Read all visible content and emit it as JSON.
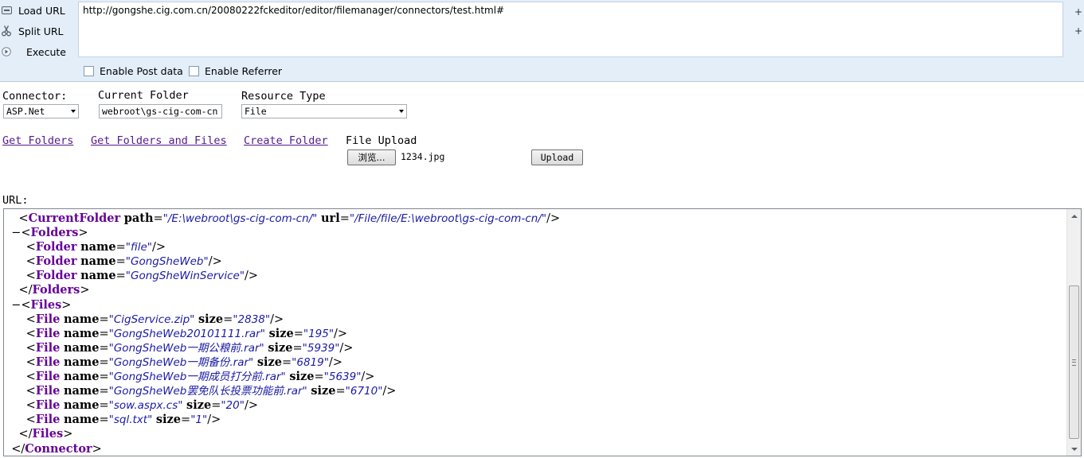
{
  "hackbar": {
    "load_url": "Load URL",
    "split_url": "Split URL",
    "execute": "Execute",
    "url_value": "http://gongshe.cig.com.cn/20080222fckeditor/editor/filemanager/connectors/test.html#",
    "plus": "+",
    "enable_post": "Enable Post data",
    "enable_referrer": "Enable Referrer"
  },
  "form": {
    "connector_label": "Connector:",
    "connector_value": "ASP.Net",
    "current_folder_label": "Current Folder",
    "current_folder_value": "webroot\\gs-cig-com-cn",
    "resource_type_label": "Resource Type",
    "resource_type_value": "File",
    "get_folders": "Get Folders",
    "get_folders_files": "Get Folders and Files",
    "create_folder": "Create Folder",
    "file_upload_label": "File Upload",
    "browse_button": "浏览...",
    "file_name": "1234.jpg",
    "upload_button": "Upload",
    "url_label": "URL:"
  },
  "xml": {
    "lines": [
      {
        "indent": "    ",
        "toggle": "",
        "tag": "CurrentFolder",
        "close": false,
        "self": false,
        "attrs": [
          {
            "n": "path",
            "v": "/E:\\webroot\\gs-cig-com-cn/"
          },
          {
            "n": "url",
            "v": "/File/file/E:\\webroot\\gs-cig-com-cn/"
          }
        ],
        "end": "/>"
      },
      {
        "indent": "  ",
        "toggle": "−",
        "tag": "Folders",
        "close": false,
        "attrs": [],
        "end": ">"
      },
      {
        "indent": "      ",
        "toggle": "",
        "tag": "Folder",
        "close": false,
        "attrs": [
          {
            "n": "name",
            "v": "file"
          }
        ],
        "end": "/>"
      },
      {
        "indent": "      ",
        "toggle": "",
        "tag": "Folder",
        "close": false,
        "attrs": [
          {
            "n": "name",
            "v": "GongSheWeb"
          }
        ],
        "end": "/>"
      },
      {
        "indent": "      ",
        "toggle": "",
        "tag": "Folder",
        "close": false,
        "attrs": [
          {
            "n": "name",
            "v": "GongSheWinService"
          }
        ],
        "end": "/>"
      },
      {
        "indent": "    ",
        "toggle": "",
        "tag": "Folders",
        "close": true,
        "attrs": [],
        "end": ">"
      },
      {
        "indent": "  ",
        "toggle": "−",
        "tag": "Files",
        "close": false,
        "attrs": [],
        "end": ">"
      },
      {
        "indent": "      ",
        "toggle": "",
        "tag": "File",
        "close": false,
        "attrs": [
          {
            "n": "name",
            "v": "CigService.zip"
          },
          {
            "n": "size",
            "v": "2838"
          }
        ],
        "end": "/>"
      },
      {
        "indent": "      ",
        "toggle": "",
        "tag": "File",
        "close": false,
        "attrs": [
          {
            "n": "name",
            "v": "GongSheWeb20101111.rar"
          },
          {
            "n": "size",
            "v": "195"
          }
        ],
        "end": "/>"
      },
      {
        "indent": "      ",
        "toggle": "",
        "tag": "File",
        "close": false,
        "attrs": [
          {
            "n": "name",
            "v": "GongSheWeb一期公粮前.rar"
          },
          {
            "n": "size",
            "v": "5939"
          }
        ],
        "end": "/>"
      },
      {
        "indent": "      ",
        "toggle": "",
        "tag": "File",
        "close": false,
        "attrs": [
          {
            "n": "name",
            "v": "GongSheWeb一期备份.rar"
          },
          {
            "n": "size",
            "v": "6819"
          }
        ],
        "end": "/>"
      },
      {
        "indent": "      ",
        "toggle": "",
        "tag": "File",
        "close": false,
        "attrs": [
          {
            "n": "name",
            "v": "GongSheWeb一期成员打分前.rar"
          },
          {
            "n": "size",
            "v": "5639"
          }
        ],
        "end": "/>"
      },
      {
        "indent": "      ",
        "toggle": "",
        "tag": "File",
        "close": false,
        "attrs": [
          {
            "n": "name",
            "v": "GongSheWeb罢免队长投票功能前.rar"
          },
          {
            "n": "size",
            "v": "6710"
          }
        ],
        "end": "/>"
      },
      {
        "indent": "      ",
        "toggle": "",
        "tag": "File",
        "close": false,
        "attrs": [
          {
            "n": "name",
            "v": "sow.aspx.cs"
          },
          {
            "n": "size",
            "v": "20"
          }
        ],
        "end": "/>"
      },
      {
        "indent": "      ",
        "toggle": "",
        "tag": "File",
        "close": false,
        "attrs": [
          {
            "n": "name",
            "v": "sql.txt"
          },
          {
            "n": "size",
            "v": "1"
          }
        ],
        "end": "/>"
      },
      {
        "indent": "    ",
        "toggle": "",
        "tag": "Files",
        "close": true,
        "attrs": [],
        "end": ">"
      },
      {
        "indent": "  ",
        "toggle": "",
        "tag": "Connector",
        "close": true,
        "attrs": [],
        "end": ">"
      }
    ]
  }
}
